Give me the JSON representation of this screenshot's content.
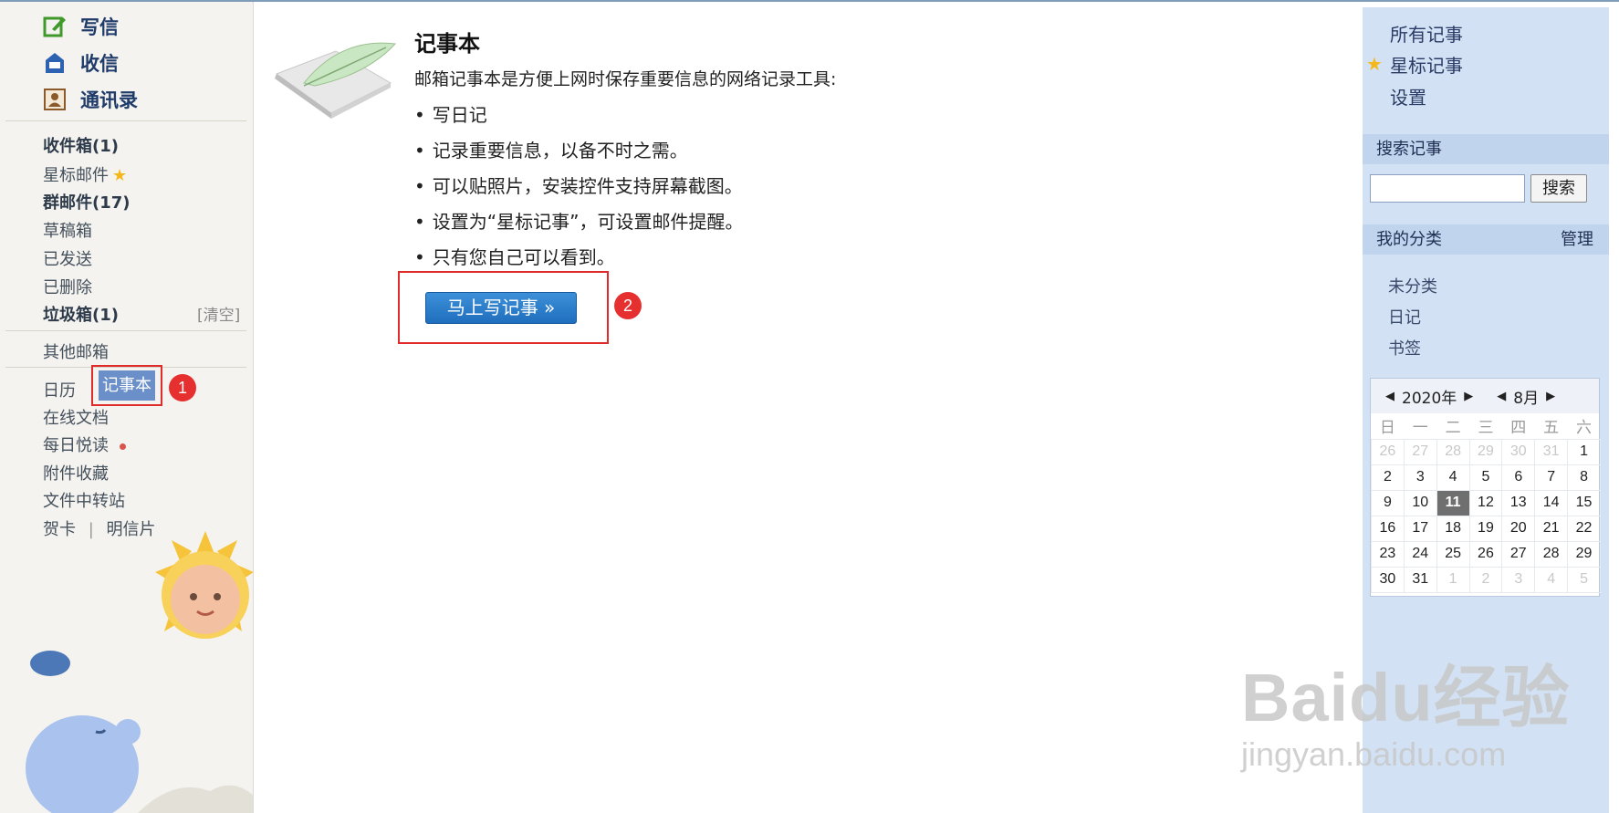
{
  "quick_actions": [
    {
      "label": "写信",
      "icon": "compose-icon"
    },
    {
      "label": "收信",
      "icon": "inbox-icon"
    },
    {
      "label": "通讯录",
      "icon": "contacts-icon"
    }
  ],
  "folders": {
    "inbox": "收件箱(1)",
    "starred": "星标邮件",
    "group": "群邮件(17)",
    "drafts": "草稿箱",
    "sent": "已发送",
    "deleted": "已删除",
    "spam": "垃圾箱(1)",
    "spam_clear": "[清空]",
    "other": "其他邮箱"
  },
  "apps": {
    "calendar": "日历",
    "notebook": "记事本",
    "online_docs": "在线文档",
    "daily_read": "每日悦读",
    "attachments": "附件收藏",
    "file_transfer": "文件中转站",
    "greeting_card": "贺卡",
    "divider": "|",
    "postcard": "明信片"
  },
  "badges": {
    "one": "1",
    "two": "2"
  },
  "main": {
    "title": "记事本",
    "intro": "邮箱记事本是方便上网时保存重要信息的网络记录工具:",
    "bullets": [
      "写日记",
      "记录重要信息，以备不时之需。",
      "可以贴照片，安装控件支持屏幕截图。",
      "设置为“星标记事”，可设置邮件提醒。",
      "只有您自己可以看到。"
    ],
    "write_button": "马上写记事 »"
  },
  "right": {
    "links": [
      "所有记事",
      "星标记事",
      "设置"
    ],
    "search_header": "搜索记事",
    "search_button": "搜索",
    "category_header": "我的分类",
    "manage": "管理",
    "categories": [
      "未分类",
      "日记",
      "书签"
    ]
  },
  "calendar": {
    "year": "2020年",
    "month": "8月",
    "weekdays": [
      "日",
      "一",
      "二",
      "三",
      "四",
      "五",
      "六"
    ],
    "weeks": [
      [
        "26",
        "27",
        "28",
        "29",
        "30",
        "31",
        "1"
      ],
      [
        "2",
        "3",
        "4",
        "5",
        "6",
        "7",
        "8"
      ],
      [
        "9",
        "10",
        "11",
        "12",
        "13",
        "14",
        "15"
      ],
      [
        "16",
        "17",
        "18",
        "19",
        "20",
        "21",
        "22"
      ],
      [
        "23",
        "24",
        "25",
        "26",
        "27",
        "28",
        "29"
      ],
      [
        "30",
        "31",
        "1",
        "2",
        "3",
        "4",
        "5"
      ]
    ],
    "today": "11"
  },
  "watermark": {
    "main": "Baidu经验",
    "sub": "jingyan.baidu.com"
  },
  "colors": {
    "accent_blue": "#1f6fbe",
    "highlight_red": "#e02b2b",
    "panel_blue": "#d2e1f4"
  }
}
